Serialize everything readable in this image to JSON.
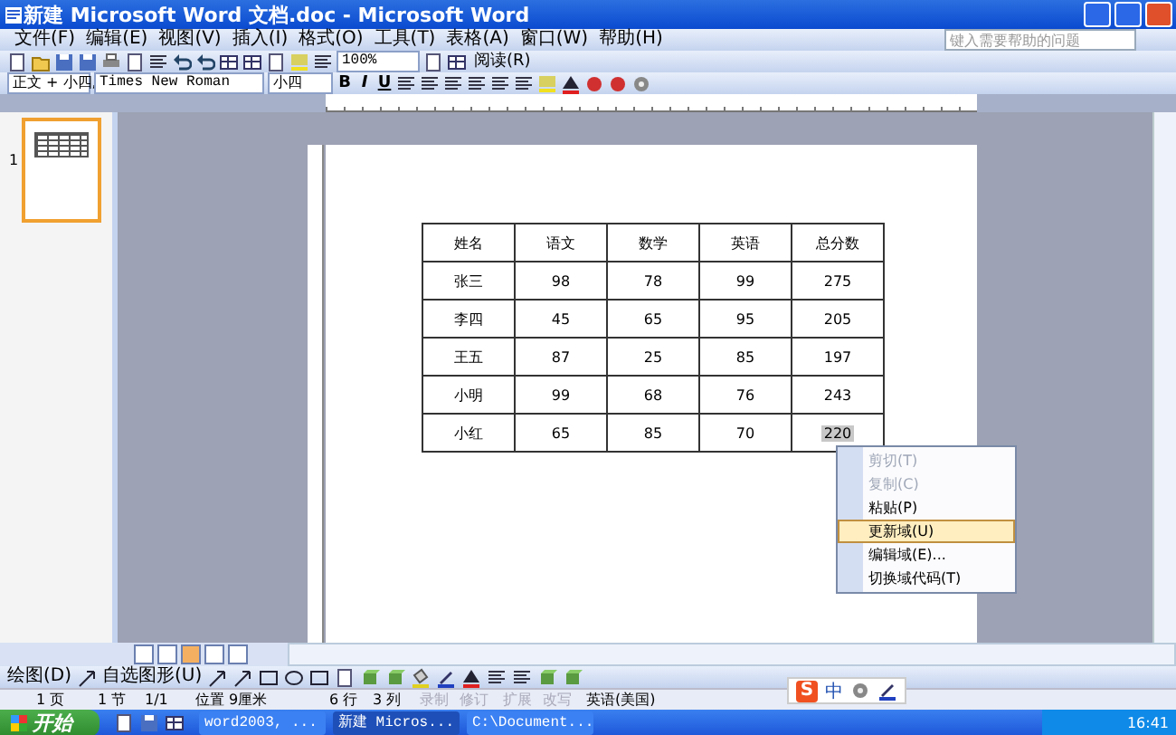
{
  "window": {
    "title": "新建 Microsoft Word 文档.doc - Microsoft Word"
  },
  "menu_bar": {
    "items": [
      "文件(F)",
      "编辑(E)",
      "视图(V)",
      "插入(I)",
      "格式(O)",
      "工具(T)",
      "表格(A)",
      "窗口(W)",
      "帮助(H)"
    ]
  },
  "help_search": {
    "placeholder": "键入需要帮助的问题"
  },
  "standard_toolbar": {
    "zoom": "100%",
    "read_button": "阅读(R)"
  },
  "formatting_toolbar": {
    "style": "正文 + 小四,",
    "font": "Times New Roman",
    "size": "小四",
    "bold": "B",
    "italic": "I",
    "underline": "U"
  },
  "thumbnails": [
    {
      "label": "1",
      "selected": true
    }
  ],
  "table": {
    "rows": [
      [
        "姓名",
        "语文",
        "数学",
        "英语",
        "总分数"
      ],
      [
        "张三",
        "98",
        "78",
        "99",
        "275"
      ],
      [
        "李四",
        "45",
        "65",
        "95",
        "205"
      ],
      [
        "王五",
        "87",
        "25",
        "85",
        "197"
      ],
      [
        "小明",
        "99",
        "68",
        "76",
        "243"
      ],
      [
        "小红",
        "65",
        "85",
        "70",
        "220"
      ]
    ]
  },
  "context_menu": {
    "items": [
      {
        "label": "剪切(T)",
        "disabled": true,
        "selected": false
      },
      {
        "label": "复制(C)",
        "disabled": true,
        "selected": false
      },
      {
        "label": "粘贴(P)",
        "disabled": false,
        "selected": false
      },
      {
        "label": "更新域(U)",
        "disabled": false,
        "selected": true
      },
      {
        "label": "编辑域(E)...",
        "disabled": false,
        "selected": false
      },
      {
        "label": "切换域代码(T)",
        "disabled": false,
        "selected": false
      }
    ]
  },
  "drawing_toolbar": {
    "draw_menu": "绘图(D)",
    "autoshapes_menu": "自选图形(U)"
  },
  "status_bar": {
    "items": [
      {
        "text": "1 页",
        "disabled": false
      },
      {
        "text": "1 节",
        "disabled": false
      },
      {
        "text": "1/1",
        "disabled": false
      },
      {
        "text": "位置 9厘米",
        "disabled": false
      },
      {
        "text": "6 行",
        "disabled": false
      },
      {
        "text": "3 列",
        "disabled": false
      },
      {
        "text": "录制",
        "disabled": true
      },
      {
        "text": "修订",
        "disabled": true
      },
      {
        "text": "扩展",
        "disabled": true
      },
      {
        "text": "改写",
        "disabled": true
      },
      {
        "text": "英语(美国)",
        "disabled": false
      }
    ]
  },
  "ime_bar": {
    "logo": "S",
    "mode": "中"
  },
  "taskbar": {
    "start": "开始",
    "tasks": [
      {
        "label": "word2003, ...",
        "selected": false
      },
      {
        "label": "新建 Micros...",
        "selected": true
      },
      {
        "label": "C:\\Document...",
        "selected": false
      }
    ],
    "clock": "16:41"
  }
}
